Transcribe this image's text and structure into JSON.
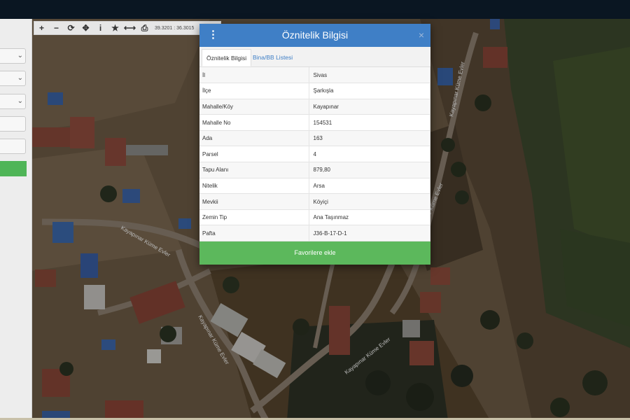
{
  "toolbar": {
    "buttons": [
      {
        "label": "+",
        "icon": "zoom-in-icon"
      },
      {
        "label": "−",
        "icon": "zoom-out-icon"
      },
      {
        "label": "⟳",
        "icon": "refresh-icon"
      },
      {
        "label": "✥",
        "icon": "locate-icon"
      },
      {
        "label": "i",
        "icon": "info-icon"
      },
      {
        "label": "★",
        "icon": "star-icon"
      },
      {
        "label": "⟷",
        "icon": "measure-icon"
      },
      {
        "label": "⎙",
        "icon": "print-icon"
      }
    ],
    "coordinates": "39.3201 : 36.3015"
  },
  "modal": {
    "title": "Öznitelik Bilgisi",
    "menu_icon": "⋮",
    "close_icon": "×",
    "tabs": [
      {
        "label": "Öznitelik Bilgisi",
        "active": true
      },
      {
        "label": "Bina/BB Listesi",
        "active": false
      }
    ],
    "rows": [
      {
        "label": "İl",
        "value": "Sivas"
      },
      {
        "label": "İlçe",
        "value": "Şarkışla"
      },
      {
        "label": "Mahalle/Köy",
        "value": "Kayapınar"
      },
      {
        "label": "Mahalle No",
        "value": "154531"
      },
      {
        "label": "Ada",
        "value": "163"
      },
      {
        "label": "Parsel",
        "value": "4"
      },
      {
        "label": "Tapu Alanı",
        "value": "879,80"
      },
      {
        "label": "Nitelik",
        "value": "Arsa"
      },
      {
        "label": "Mevkii",
        "value": "Köyiçi"
      },
      {
        "label": "Zemin Tip",
        "value": "Ana Taşınmaz"
      },
      {
        "label": "Pafta",
        "value": "J36-B-17-D-1"
      }
    ],
    "favorite_button": "Favorilere ekle"
  },
  "map": {
    "street_labels": [
      "Kayapınar Küme Evler",
      "Kayapınar Küme Evler",
      "Kayapınar Küme Evler",
      "Kayapınar Küme Evler",
      "Kayapınar Küme Evler"
    ]
  },
  "colors": {
    "header_blue": "#3f7fc6",
    "button_green": "#5cb85c",
    "topbar": "#0a1622"
  }
}
